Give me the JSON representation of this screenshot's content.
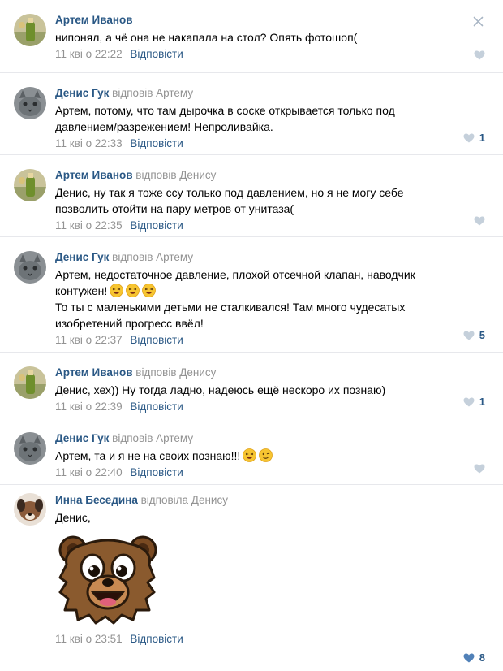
{
  "colors": {
    "link": "#2a5885",
    "muted": "#939393",
    "like_empty": "#c5d0db",
    "like_active": "#5181b8",
    "divider": "#e7e8ec"
  },
  "comments": [
    {
      "author": "Артем Иванов",
      "reply_to": "",
      "lines": [
        "нипонял, а чё она не накапала на стол? Опять фотошоп("
      ],
      "date": "11 кві о 22:22",
      "reply_label": "Відповісти",
      "likes": "",
      "avatar": "bottle-avatar"
    },
    {
      "author": "Денис Гук",
      "reply_to": "відповів Артему",
      "lines": [
        "Артем, потому, что там дырочка в соске открывается только под",
        "давлением/разрежением! Непроливайка."
      ],
      "date": "11 кві о 22:33",
      "reply_label": "Відповісти",
      "likes": "1",
      "avatar": "cat-avatar"
    },
    {
      "author": "Артем Иванов",
      "reply_to": "відповів Денису",
      "lines": [
        "Денис, ну так я тоже ссу только под давлением, но я не могу себе",
        "позволить отойти на пару метров от унитаза("
      ],
      "date": "11 кві о 22:35",
      "reply_label": "Відповісти",
      "likes": "",
      "avatar": "bottle-avatar"
    },
    {
      "author": "Денис Гук",
      "reply_to": "відповів Артему",
      "lines": [
        "Артем, недостаточное давление, плохой отсечной клапан, наводчик",
        "контужен!",
        "То ты с маленькими детьми не сталкивался! Там много чудесатых",
        "изобретений прогресс ввёл!"
      ],
      "date": "11 кві о 22:37",
      "reply_label": "Відповісти",
      "likes": "5",
      "avatar": "cat-avatar",
      "emoji": [
        "laughing-emoji",
        "laughing-emoji",
        "laughing-emoji"
      ]
    },
    {
      "author": "Артем Иванов",
      "reply_to": "відповів Денису",
      "lines": [
        "Денис, хех)) Ну тогда ладно, надеюсь ещё нескоро их познаю)"
      ],
      "date": "11 кві о 22:39",
      "reply_label": "Відповісти",
      "likes": "1",
      "avatar": "bottle-avatar"
    },
    {
      "author": "Денис Гук",
      "reply_to": "відповів Артему",
      "lines": [
        "Артем, та и я не на своих познаю!!!"
      ],
      "date": "11 кві о 22:40",
      "reply_label": "Відповісти",
      "likes": "",
      "avatar": "cat-avatar",
      "emoji": [
        "laughing-emoji",
        "wink-emoji"
      ]
    },
    {
      "author": "Инна Беседина",
      "reply_to": "відповіла Денису",
      "lines": [
        "Денис,"
      ],
      "date": "11 кві о 23:51",
      "reply_label": "Відповісти",
      "likes": "8",
      "avatar": "dog-avatar",
      "sticker": "bear-sticker"
    }
  ]
}
